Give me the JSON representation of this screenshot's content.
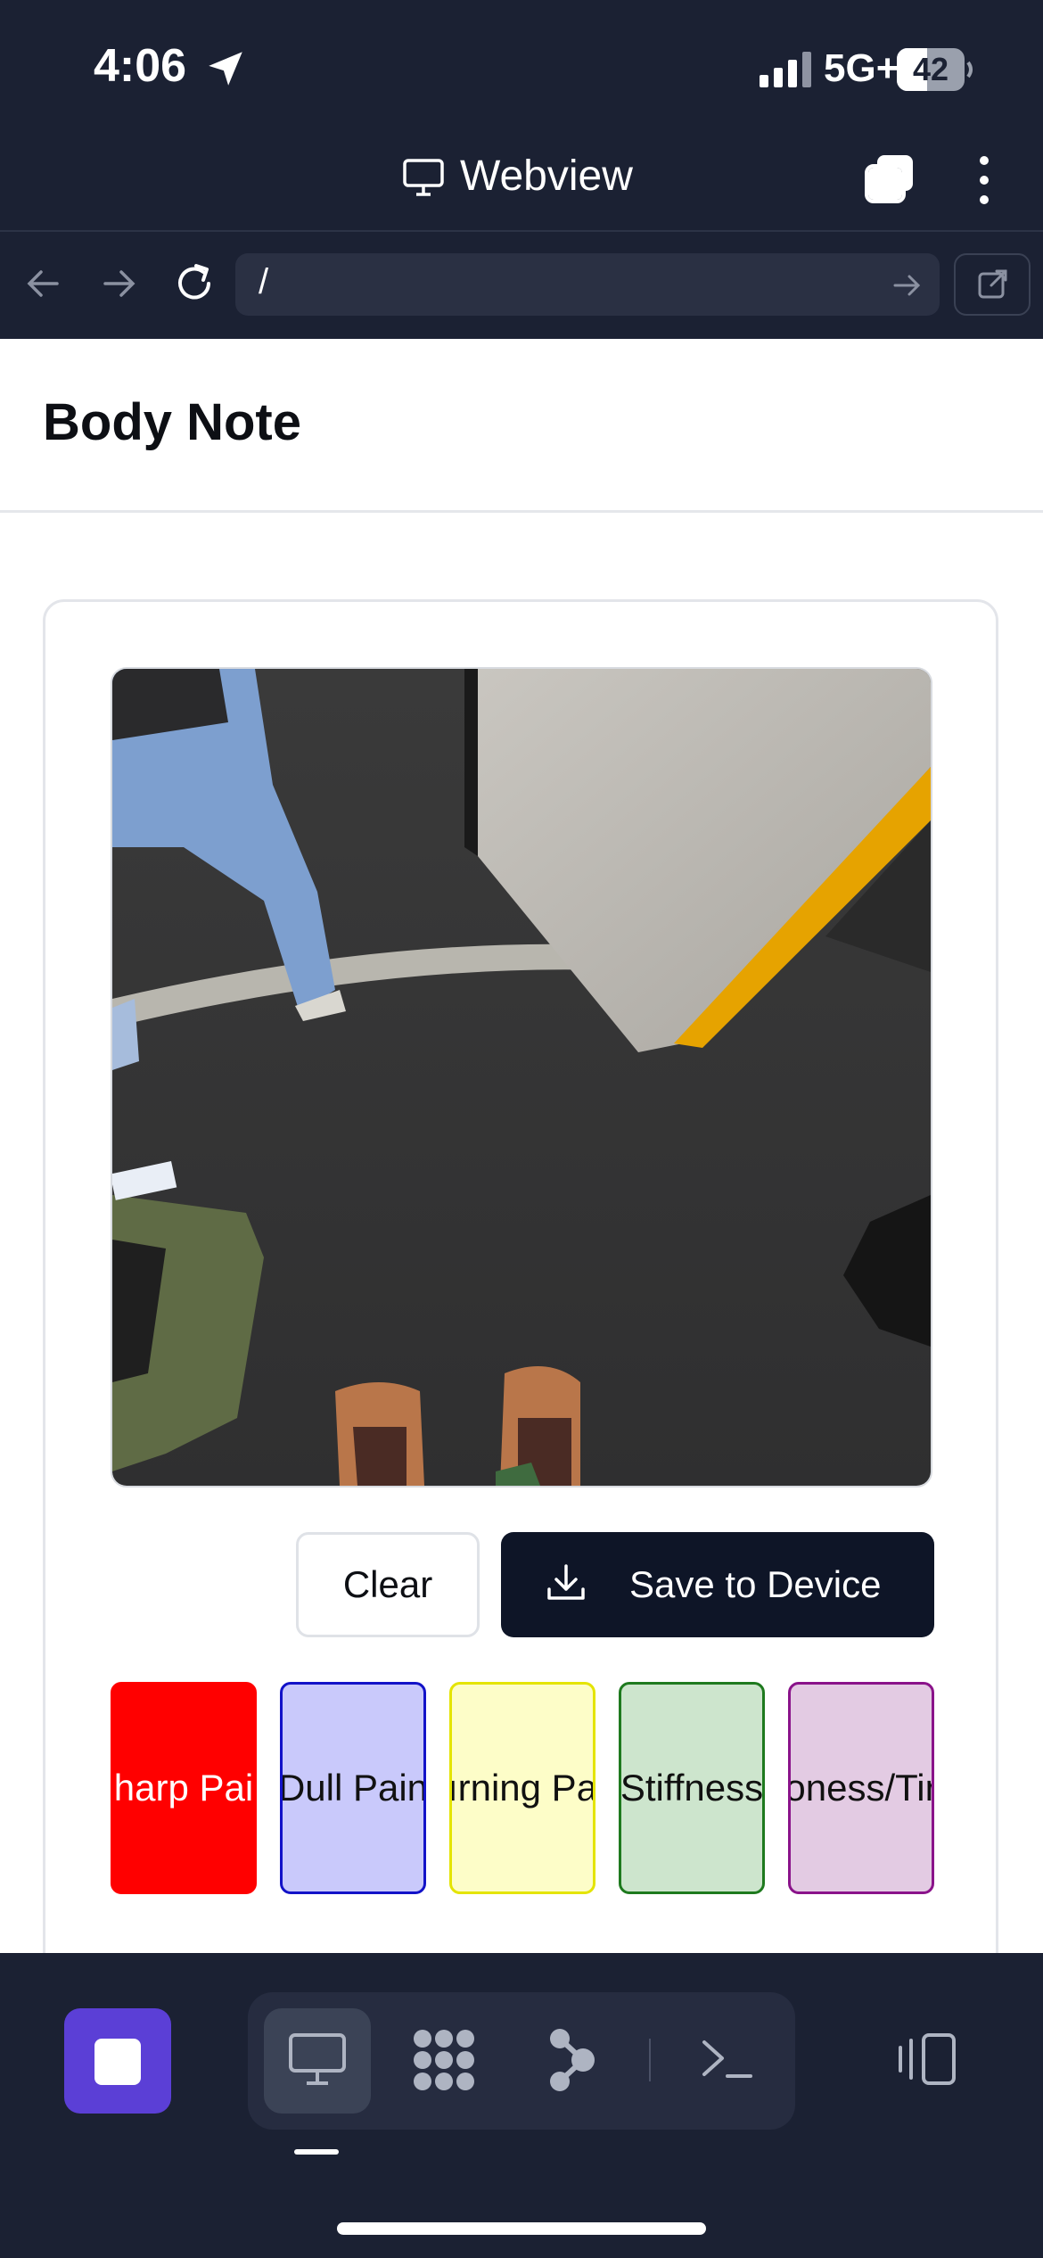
{
  "status_bar": {
    "time": "4:06",
    "network": "5G+",
    "battery": "42"
  },
  "browser": {
    "title": "Webview",
    "url": "/"
  },
  "page": {
    "title": "Body Note"
  },
  "actions": {
    "clear_label": "Clear",
    "save_label": "Save to Device"
  },
  "tags": [
    {
      "label": "harp Pai",
      "bg": "#ff0000",
      "border": "#ff0000"
    },
    {
      "label": "Dull Pain",
      "bg": "#c9c9fb",
      "border": "#1212c8"
    },
    {
      "label": "ırning Pa",
      "bg": "#fdfdc8",
      "border": "#e4e400"
    },
    {
      "label": "Stiffness",
      "bg": "#cde5cd",
      "border": "#1e7a1e"
    },
    {
      "label": "oness/Tir",
      "bg": "#e3cbe3",
      "border": "#8a138a"
    }
  ],
  "colors": {
    "chrome": "#1b2133",
    "primary_button": "#0e1527",
    "app_accent": "#5b3fd6"
  },
  "icons": [
    "location-arrow-icon",
    "signal-bars-icon",
    "battery-icon",
    "monitor-icon",
    "tabs-icon",
    "more-vertical-icon",
    "back-arrow-icon",
    "forward-arrow-icon",
    "reload-icon",
    "go-arrow-icon",
    "open-external-icon",
    "download-icon",
    "desktop-icon",
    "dots-grid-icon",
    "graph-icon",
    "terminal-icon",
    "side-panel-icon"
  ]
}
